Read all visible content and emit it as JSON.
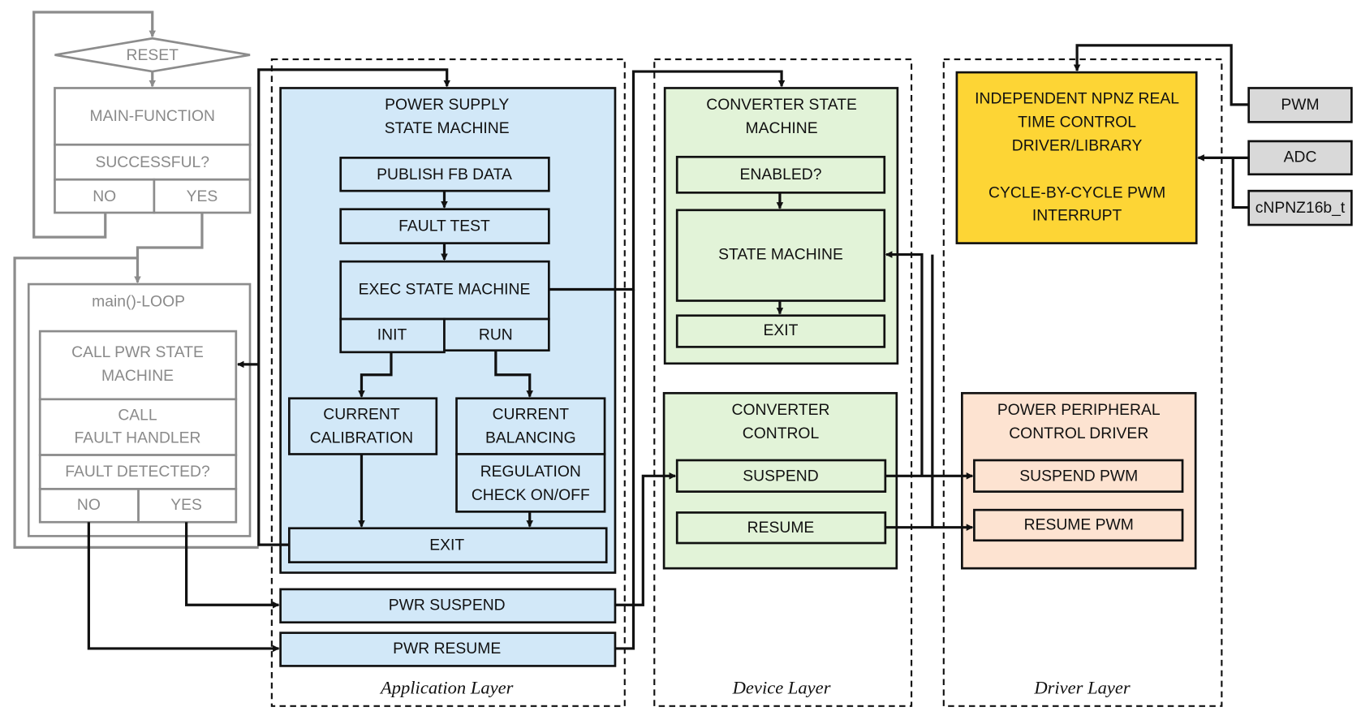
{
  "startup": {
    "reset": "RESET",
    "main_function": "MAIN-FUNCTION",
    "successful": "SUCCESSFUL?",
    "no": "NO",
    "yes": "YES"
  },
  "main_loop": {
    "title": "main()-LOOP",
    "call_pwr": [
      "CALL PWR STATE",
      "MACHINE"
    ],
    "call_fault": [
      "CALL",
      "FAULT HANDLER"
    ],
    "fault_detected": "FAULT DETECTED?",
    "no": "NO",
    "yes": "YES"
  },
  "application_layer": {
    "label": "Application Layer",
    "psm_title": [
      "POWER SUPPLY",
      "STATE MACHINE"
    ],
    "publish": "PUBLISH FB DATA",
    "fault_test": "FAULT TEST",
    "exec": "EXEC STATE MACHINE",
    "init": "INIT",
    "run": "RUN",
    "calibration": [
      "CURRENT",
      "CALIBRATION"
    ],
    "balancing": [
      "CURRENT",
      "BALANCING"
    ],
    "regulation": [
      "REGULATION",
      "CHECK ON/OFF"
    ],
    "exit": "EXIT",
    "pwr_suspend": "PWR SUSPEND",
    "pwr_resume": "PWR RESUME"
  },
  "device_layer": {
    "label": "Device Layer",
    "csm_title": [
      "CONVERTER STATE",
      "MACHINE"
    ],
    "enabled": "ENABLED?",
    "state_machine": "STATE MACHINE",
    "exit": "EXIT",
    "cc_title": [
      "CONVERTER",
      "CONTROL"
    ],
    "suspend": "SUSPEND",
    "resume": "RESUME"
  },
  "driver_layer": {
    "label": "Driver Layer",
    "npnz": [
      "INDEPENDENT NPNZ REAL",
      "TIME CONTROL",
      "DRIVER/LIBRARY",
      "CYCLE-BY-CYCLE PWM",
      "INTERRUPT"
    ],
    "ppc_title": [
      "POWER PERIPHERAL",
      "CONTROL DRIVER"
    ],
    "suspend_pwm": "SUSPEND PWM",
    "resume_pwm": "RESUME PWM"
  },
  "inputs": [
    "PWM",
    "ADC",
    "cNPNZ16b_t"
  ],
  "colors": {
    "application": "#d2e8f8",
    "device": "#e2f3d8",
    "driver_core": "#fdd535",
    "driver_peripheral": "#fde3d1",
    "input": "#d9d9d9",
    "startup": "#8c8c8c"
  }
}
